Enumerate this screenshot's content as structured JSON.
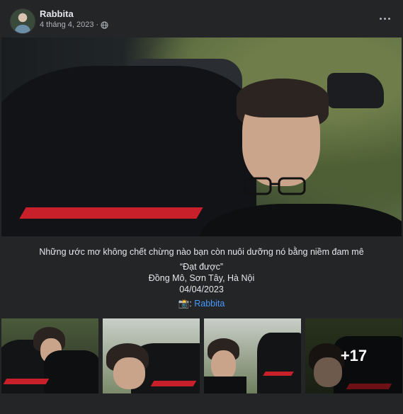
{
  "post": {
    "author": "Rabbita",
    "date": "4 tháng 4, 2023",
    "separator": "·",
    "privacy_icon": "globe-icon",
    "more_icon": "more-horizontal-icon"
  },
  "caption": {
    "line1": "Những ước mơ không chết chừng nào bạn còn nuôi dưỡng nó bằng niềm đam mê",
    "line2": "“Đạt được”",
    "line3": "Đồng Mô, Sơn Tây, Hà Nội",
    "line4": "04/04/2023",
    "credit_emoji": "📸:",
    "credit_name": "Rabbita"
  },
  "photos": {
    "more_count": "+17"
  },
  "colors": {
    "background": "#242526",
    "text": "#e4e6eb",
    "secondary_text": "#b0b3b8",
    "link": "#4599ff"
  }
}
